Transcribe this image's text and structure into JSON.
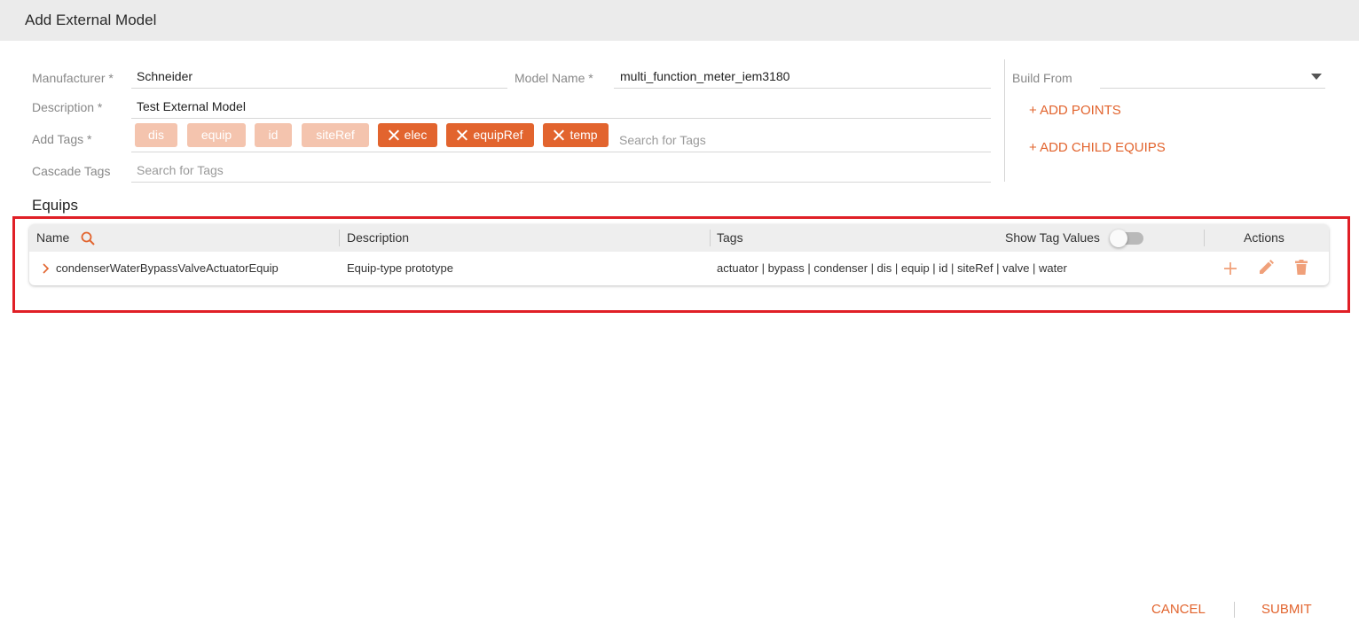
{
  "dialog": {
    "title": "Add External Model"
  },
  "form": {
    "manufacturer": {
      "label": "Manufacturer",
      "required_mark": "*",
      "value": "Schneider"
    },
    "model_name": {
      "label": "Model Name",
      "required_mark": "*",
      "value": "multi_function_meter_iem3180"
    },
    "description": {
      "label": "Description",
      "required_mark": "*",
      "value": "Test External Model"
    },
    "add_tags": {
      "label": "Add Tags",
      "required_mark": "*",
      "inherited_tags": [
        "dis",
        "equip",
        "id",
        "siteRef"
      ],
      "custom_tags": [
        "elec",
        "equipRef",
        "temp"
      ],
      "placeholder": "Search for Tags"
    },
    "cascade_tags": {
      "label": "Cascade Tags",
      "placeholder": "Search for Tags"
    },
    "build_from": {
      "label": "Build From",
      "value": ""
    },
    "add_points_label": "+ ADD POINTS",
    "add_child_equips_label": "+ ADD CHILD EQUIPS"
  },
  "equips": {
    "title": "Equips",
    "columns": {
      "name": "Name",
      "description": "Description",
      "tags": "Tags",
      "show_tag_values": "Show Tag Values",
      "actions": "Actions"
    },
    "show_tag_values_on": false,
    "rows": [
      {
        "name": "condenserWaterBypassValveActuatorEquip",
        "description": "Equip-type prototype",
        "tags": "actuator | bypass | condenser | dis | equip | id | siteRef | valve | water"
      }
    ]
  },
  "footer": {
    "cancel_label": "CANCEL",
    "submit_label": "SUBMIT"
  },
  "colors": {
    "accent": "#e2642e",
    "accent_light": "#f4c4ae",
    "highlight": "#e01f26"
  }
}
